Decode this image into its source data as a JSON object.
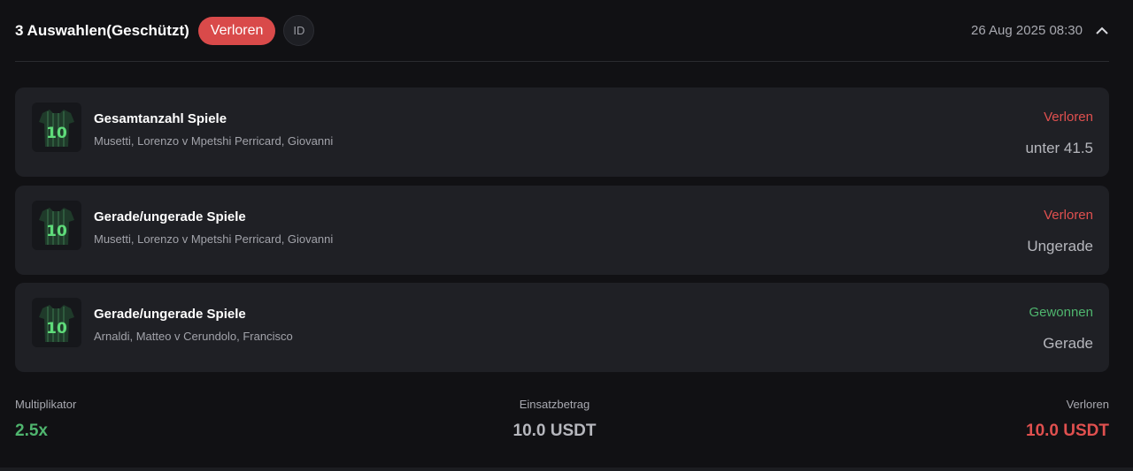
{
  "header": {
    "title": "3 Auswahlen(Geschützt)",
    "status": "Verloren",
    "id_label": "ID",
    "datetime": "26 Aug 2025 08:30",
    "collapse_icon": "chevron-up-icon"
  },
  "selections": [
    {
      "market": "Gesamtanzahl Spiele",
      "match": "Musetti, Lorenzo v Mpetshi Perricard, Giovanni",
      "result": "Verloren",
      "pick": "unter 41.5",
      "icon": "jersey-icon"
    },
    {
      "market": "Gerade/ungerade Spiele",
      "match": "Musetti, Lorenzo v Mpetshi Perricard, Giovanni",
      "result": "Verloren",
      "pick": "Ungerade",
      "icon": "jersey-icon"
    },
    {
      "market": "Gerade/ungerade Spiele",
      "match": "Arnaldi, Matteo v Cerundolo, Francisco",
      "result": "Gewonnen",
      "pick": "Gerade",
      "icon": "jersey-icon"
    }
  ],
  "summary": {
    "multiplier_label": "Multiplikator",
    "multiplier_value": "2.5x",
    "stake_label": "Einsatzbetrag",
    "stake_value": "10.0 USDT",
    "outcome_label": "Verloren",
    "outcome_value": "10.0 USDT"
  },
  "colors": {
    "background": "#111114",
    "card": "#1f2025",
    "lost": "#e0504f",
    "won": "#4fb56e",
    "status_pill": "#d94a4a"
  }
}
